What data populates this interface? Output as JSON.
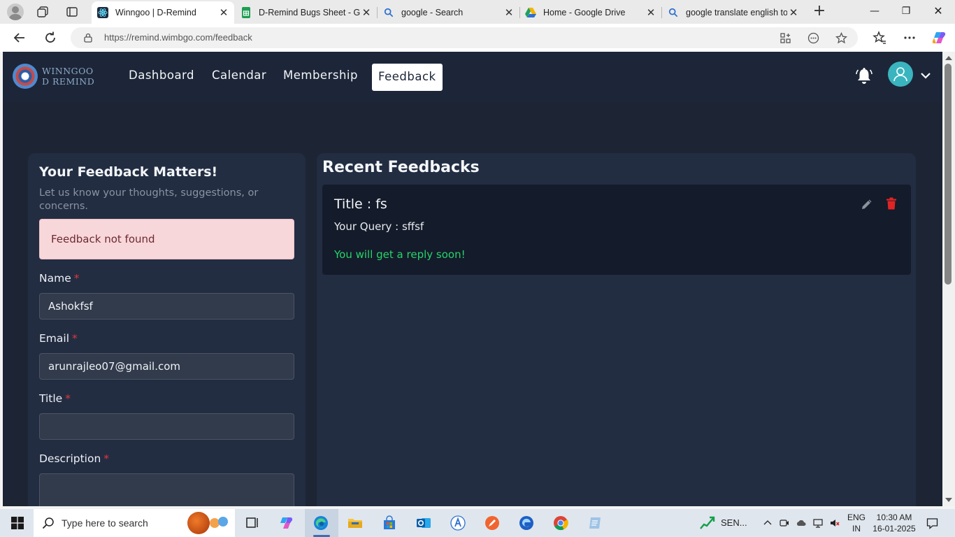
{
  "browser": {
    "tabs": [
      {
        "title": "Winngoo | D-Remind",
        "active": true,
        "favicon": "react-atom-icon"
      },
      {
        "title": "D-Remind Bugs Sheet - Go",
        "active": false,
        "favicon": "google-sheets-icon"
      },
      {
        "title": "google - Search",
        "active": false,
        "favicon": "search-icon"
      },
      {
        "title": "Home - Google Drive",
        "active": false,
        "favicon": "google-drive-icon"
      },
      {
        "title": "google translate english to",
        "active": false,
        "favicon": "search-icon"
      }
    ],
    "url": "https://remind.wimbgo.com/feedback"
  },
  "app": {
    "logo_line1": "WINNGOO",
    "logo_line2": "D REMIND",
    "nav": [
      "Dashboard",
      "Calendar",
      "Membership",
      "Feedback"
    ],
    "active_nav": "Feedback"
  },
  "form": {
    "heading": "Your Feedback Matters!",
    "subheading": "Let us know your thoughts, suggestions, or concerns.",
    "alert": "Feedback not found",
    "required_mark": "*",
    "name_label": "Name",
    "name_value": "Ashokfsf",
    "email_label": "Email",
    "email_value": "arunrajleo07@gmail.com",
    "title_label": "Title",
    "title_value": "",
    "description_label": "Description",
    "description_value": ""
  },
  "recent": {
    "heading": "Recent Feedbacks",
    "items": [
      {
        "title": "Title : fs",
        "query": "Your Query : sffsf",
        "status": "You will get a reply soon!"
      }
    ]
  },
  "taskbar": {
    "search_placeholder": "Type here to search",
    "stock_label": "SEN...",
    "lang_line1": "ENG",
    "lang_line2": "IN",
    "time": "10:30 AM",
    "date": "16-01-2025"
  },
  "colors": {
    "page_bg": "#1d2534",
    "panel_bg": "#222d42",
    "alert_bg": "#f8d7da",
    "success_text": "#27d36a",
    "delete_icon": "#e02424",
    "avatar": "#3ab5bf"
  }
}
